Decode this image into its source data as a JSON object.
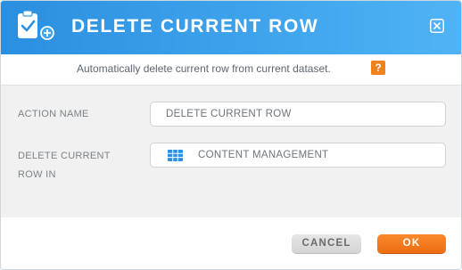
{
  "dialog": {
    "title": "DELETE CURRENT ROW",
    "title_icon": "clipboard-check-add-icon",
    "close_icon": "close-icon",
    "description": "Automatically delete current row from current dataset.",
    "help_label": "?"
  },
  "form": {
    "action_name": {
      "label": "ACTION NAME",
      "value": "DELETE CURRENT ROW"
    },
    "delete_in": {
      "label": "DELETE CURRENT ROW IN",
      "value": "CONTENT MANAGEMENT",
      "icon": "table-icon"
    }
  },
  "footer": {
    "cancel_label": "CANCEL",
    "ok_label": "OK"
  },
  "colors": {
    "header_gradient_start": "#2b8fe0",
    "header_gradient_end": "#4fb3f5",
    "accent_orange": "#f0821e",
    "body_bg": "#f1f1f1"
  }
}
